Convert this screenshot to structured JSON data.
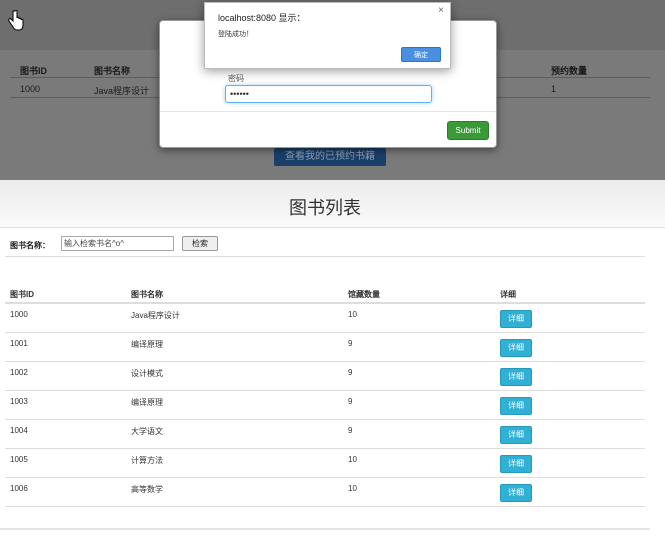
{
  "background_page": {
    "columns": [
      "图书ID",
      "图书名称",
      "预约数量"
    ],
    "row": {
      "id": "1000",
      "name": "Java程序设计",
      "count": "1"
    },
    "button_label": "查看我的已预约书籍"
  },
  "login_modal": {
    "field_label": "密码",
    "password_value": "••••••",
    "submit_label": "Submit"
  },
  "alert": {
    "title": "localhost:8080 显示：",
    "message": "登陆成功！",
    "ok_label": "确定",
    "close_label": "×"
  },
  "page": {
    "title": "图书列表",
    "search_label": "图书名称：",
    "search_placeholder": "输入检索书名^o^",
    "search_button": "检索"
  },
  "table": {
    "headers": {
      "id": "图书ID",
      "name": "图书名称",
      "count": "馆藏数量",
      "detail": "详细"
    },
    "detail_label": "详细",
    "rows": [
      {
        "id": "1000",
        "name": "Java程序设计",
        "count": "10"
      },
      {
        "id": "1001",
        "name": "编译原理",
        "count": "9"
      },
      {
        "id": "1002",
        "name": "设计模式",
        "count": "9"
      },
      {
        "id": "1003",
        "name": "编译原理",
        "count": "9"
      },
      {
        "id": "1004",
        "name": "大学语文",
        "count": "9"
      },
      {
        "id": "1005",
        "name": "计算方法",
        "count": "10"
      },
      {
        "id": "1006",
        "name": "高等数学",
        "count": "10"
      }
    ]
  },
  "colors": {
    "detail_button": "#31b0d5",
    "submit_button": "#3a9a3a",
    "alert_ok": "#4a8fe0"
  },
  "icons": {
    "cursor": "hand-pointer-icon"
  }
}
